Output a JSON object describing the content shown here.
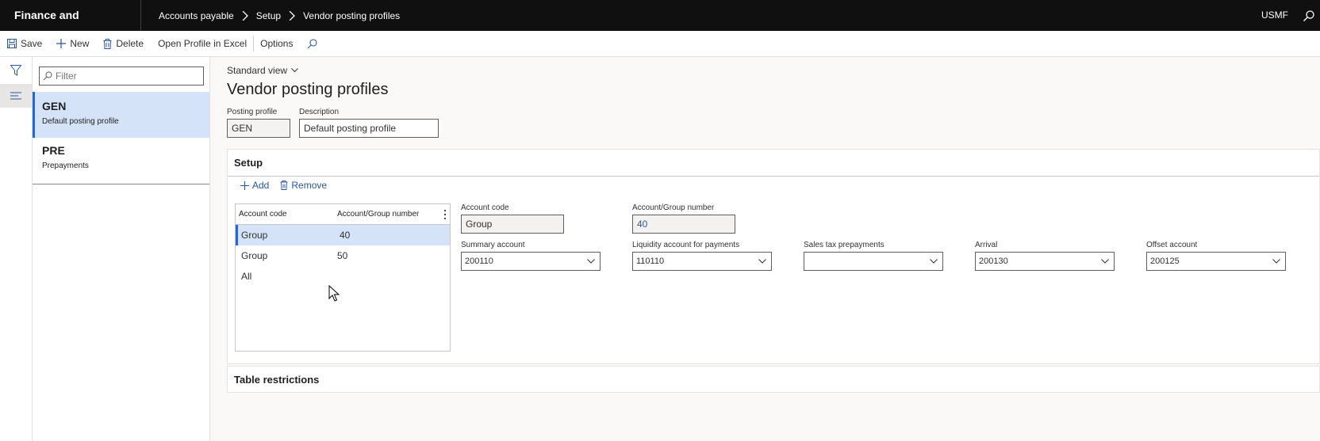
{
  "app": {
    "title": "Finance and Operations",
    "company": "USMF"
  },
  "breadcrumbs": [
    "Accounts payable",
    "Setup",
    "Vendor posting profiles"
  ],
  "actions": {
    "save": "Save",
    "new": "New",
    "delete": "Delete",
    "open_excel": "Open Profile in Excel",
    "options": "Options"
  },
  "list": {
    "filter_placeholder": "Filter",
    "items": [
      {
        "id": "GEN",
        "description": "Default posting profile"
      },
      {
        "id": "PRE",
        "description": "Prepayments"
      }
    ]
  },
  "main": {
    "view": "Standard view",
    "title": "Vendor posting profiles",
    "posting_profile": {
      "label": "Posting profile",
      "value": "GEN"
    },
    "description": {
      "label": "Description",
      "value": "Default posting profile"
    }
  },
  "setup": {
    "header": "Setup",
    "add": "Add",
    "remove": "Remove",
    "grid": {
      "columns": [
        "Account code",
        "Account/Group number"
      ],
      "rows": [
        {
          "code": "Group",
          "number": "40"
        },
        {
          "code": "Group",
          "number": "50"
        },
        {
          "code": "All",
          "number": ""
        }
      ]
    },
    "detail": {
      "account_code": {
        "label": "Account code",
        "value": "Group"
      },
      "group_number": {
        "label": "Account/Group number",
        "value": "40"
      },
      "summary_account": {
        "label": "Summary account",
        "value": "200110"
      },
      "liquidity": {
        "label": "Liquidity account for payments",
        "value": "110110"
      },
      "sales_tax": {
        "label": "Sales tax prepayments",
        "value": ""
      },
      "arrival": {
        "label": "Arrival",
        "value": "200130"
      },
      "offset": {
        "label": "Offset account",
        "value": "200125"
      }
    }
  },
  "table_restrictions": {
    "header": "Table restrictions"
  },
  "colors": {
    "nav_bg": "#101010",
    "accent": "#2266e3",
    "selected_bg": "#d5e3f8",
    "link": "#2b579a"
  }
}
